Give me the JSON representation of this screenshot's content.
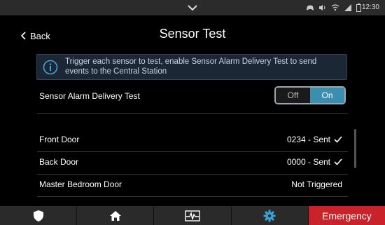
{
  "statusbar": {
    "time": "12:30",
    "icons": [
      "pulldown-chevron-icon",
      "controller-icon",
      "volume-icon",
      "wifi-icon",
      "signal-icon",
      "battery-icon"
    ]
  },
  "header": {
    "back_label": "Back",
    "title": "Sensor Test"
  },
  "info": {
    "icon": "info-icon",
    "text": "Trigger each sensor to test, enable Sensor Alarm Delivery Test to send events to the Central Station"
  },
  "delivery_test": {
    "label": "Sensor Alarm Delivery Test",
    "off_label": "Off",
    "on_label": "On",
    "selected": "On"
  },
  "sensors": [
    {
      "name": "Front Door",
      "status": "0234 - Sent",
      "checked": true
    },
    {
      "name": "Back Door",
      "status": "0000 - Sent",
      "checked": true
    },
    {
      "name": "Master Bedroom Door",
      "status": "Not Triggered",
      "checked": false
    }
  ],
  "bottom_nav": {
    "items": [
      "shield-icon",
      "home-icon",
      "activity-icon",
      "gear-icon"
    ],
    "emergency_label": "Emergency"
  },
  "colors": {
    "accent": "#3a8fb0",
    "emergency": "#c8222a",
    "info_bg": "#1c2736"
  }
}
